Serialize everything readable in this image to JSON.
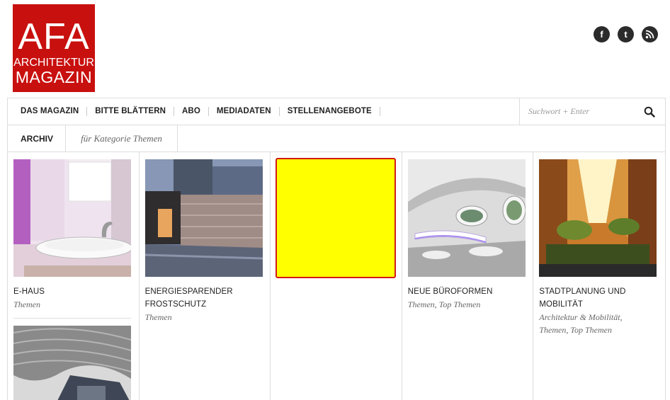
{
  "logo": {
    "line1": "AFA",
    "line2": "ARCHITEKTUR",
    "line3": "MAGAZIN"
  },
  "social": [
    {
      "name": "facebook-icon",
      "glyph": "f"
    },
    {
      "name": "twitter-icon",
      "glyph": "t"
    },
    {
      "name": "rss-icon",
      "glyph": "◉"
    }
  ],
  "nav": {
    "items": [
      "DAS MAGAZIN",
      "BITTE BLÄTTERN",
      "ABO",
      "MEDIADATEN",
      "STELLENANGEBOTE"
    ],
    "search_placeholder": "Suchwort + Enter"
  },
  "subbar": {
    "archive": "ARCHIV",
    "category": "für Kategorie Themen"
  },
  "posts": [
    {
      "title": "E-HAUS",
      "categories": [
        "Themen"
      ]
    },
    {
      "title": "ENERGIESPARENDER FROSTSCHUTZ",
      "categories": [
        "Themen"
      ]
    },
    {
      "title": "",
      "categories": []
    },
    {
      "title": "NEUE BÜROFORMEN",
      "categories": [
        "Themen",
        "Top Themen"
      ]
    },
    {
      "title": "STADTPLANUNG UND MOBILITÄT",
      "categories": [
        "Architektur & Mobilität",
        "Themen",
        "Top Themen"
      ]
    }
  ],
  "highlight_color": "#ffff00"
}
